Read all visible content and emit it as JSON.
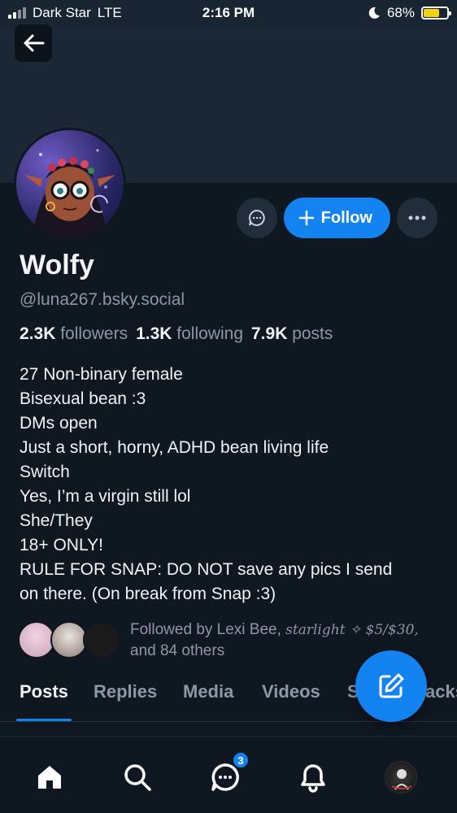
{
  "status": {
    "carrier": "Dark Star",
    "network": "LTE",
    "time": "2:16 PM",
    "battery": "68%",
    "battery_level": 0.68
  },
  "profile": {
    "display_name": "Wolfy",
    "handle": "@luna267.bsky.social",
    "followers_count": "2.3K",
    "followers_label": "followers",
    "following_count": "1.3K",
    "following_label": "following",
    "posts_count": "7.9K",
    "posts_label": "posts",
    "bio": [
      "27 Non-binary female",
      "Bisexual bean :3",
      "DMs open",
      "Just a short, horny, ADHD bean living life",
      "Switch",
      "Yes, I’m a virgin still lol",
      "She/They",
      "18+ ONLY!",
      "RULE FOR SNAP: DO NOT save any pics I send",
      "on there. (On break from Snap :3)"
    ]
  },
  "actions": {
    "follow_label": "Follow"
  },
  "followed_by": {
    "prefix": "Followed by Lexi Bee,",
    "second_name": "starlight ✧ $5/$30,",
    "suffix": "and 84 others"
  },
  "tabs": [
    "Posts",
    "Replies",
    "Media",
    "Videos",
    "S",
    "acks"
  ],
  "nav": {
    "chat_badge": "3"
  },
  "colors": {
    "accent": "#1283f0",
    "background": "#0f1721",
    "muted_text": "#8c98a8"
  }
}
